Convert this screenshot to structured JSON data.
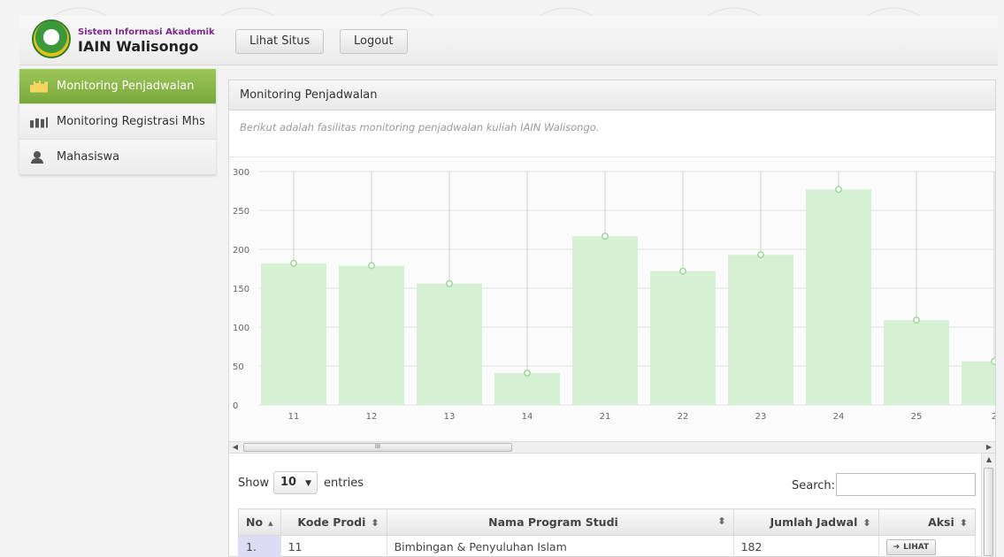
{
  "header": {
    "brand_small": "Sistem Informasi Akademik",
    "brand_big": "IAIN Walisongo",
    "buttons": {
      "lihat_situs": "Lihat Situs",
      "logout": "Logout"
    }
  },
  "sidebar": {
    "items": [
      {
        "label": "Monitoring Penjadwalan",
        "icon": "chart-icon"
      },
      {
        "label": "Monitoring Registrasi Mhs",
        "icon": "chart-icon"
      },
      {
        "label": "Mahasiswa",
        "icon": "user-icon"
      }
    ]
  },
  "panel": {
    "title": "Monitoring Penjadwalan",
    "description": "Berikut adalah fasilitas monitoring penjadwalan kuliah IAIN Walisongo."
  },
  "chart_data": {
    "type": "bar",
    "categories": [
      "11",
      "12",
      "13",
      "14",
      "21",
      "22",
      "23",
      "24",
      "25",
      "2"
    ],
    "values": [
      182,
      179,
      156,
      41,
      217,
      172,
      193,
      277,
      109,
      56
    ],
    "ylim": [
      0,
      300
    ],
    "yticks": [
      "0",
      "50",
      "100",
      "150",
      "200",
      "250",
      "300"
    ],
    "grid": true,
    "colors": {
      "bar": "#d6f0d3",
      "point": "#9fd69a"
    }
  },
  "table_controls": {
    "show_label": "Show",
    "entries_value": "10",
    "entries_label": "entries",
    "search_label": "Search:"
  },
  "table": {
    "headers": [
      "No",
      "Kode Prodi",
      "Nama Program Studi",
      "Jumlah Jadwal",
      "Aksi"
    ],
    "rows": [
      {
        "no": "1.",
        "kode": "11",
        "nama": "Bimbingan & Penyuluhan Islam",
        "jumlah": "182",
        "aksi": "LIHAT"
      }
    ]
  },
  "scrollbar": {
    "thumb_mark": "III"
  }
}
